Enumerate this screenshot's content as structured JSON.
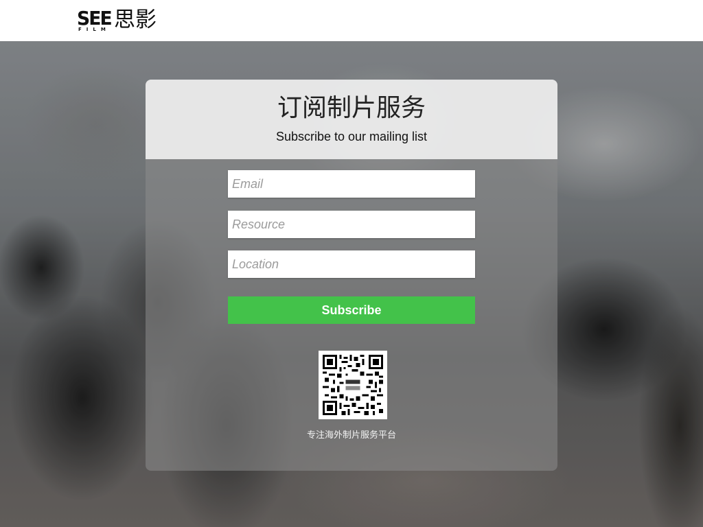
{
  "header": {
    "logo_latin": "SEE",
    "logo_film": "FILM",
    "logo_cn": "思影"
  },
  "form": {
    "title": "订阅制片服务",
    "subtitle": "Subscribe to our mailing list",
    "email_placeholder": "Email",
    "resource_placeholder": "Resource",
    "location_placeholder": "Location",
    "submit_label": "Subscribe",
    "submit_color": "#43c24a"
  },
  "footer": {
    "qr_icon": "qr-code-icon",
    "tagline": "专注海外制片服务平台"
  }
}
